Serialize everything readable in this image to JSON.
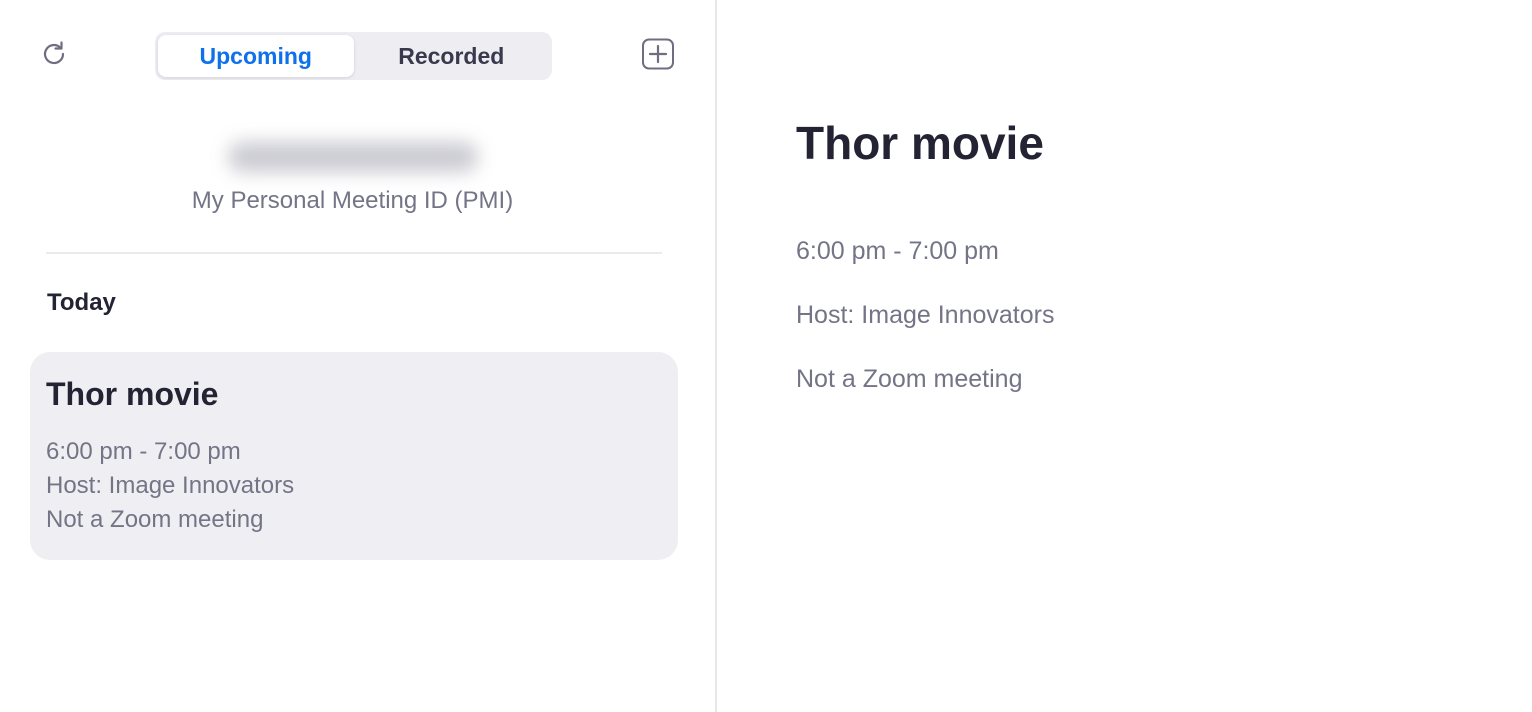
{
  "toolbar": {
    "refresh_icon": "refresh-icon",
    "add_icon": "plus-square-icon",
    "tabs": [
      {
        "label": "Upcoming",
        "active": true
      },
      {
        "label": "Recorded",
        "active": false
      }
    ]
  },
  "pmi": {
    "label": "My Personal Meeting ID (PMI)"
  },
  "list": {
    "section_heading": "Today",
    "meetings": [
      {
        "title": "Thor movie",
        "time": "6:00 pm - 7:00 pm",
        "host": "Host: Image Innovators",
        "note": "Not a Zoom meeting"
      }
    ]
  },
  "detail": {
    "title": "Thor movie",
    "time": "6:00 pm - 7:00 pm",
    "host": "Host: Image Innovators",
    "note": "Not a Zoom meeting"
  },
  "colors": {
    "accent": "#0e71eb",
    "card_bg": "#efeff3",
    "muted_text": "#747487",
    "primary_text": "#232333"
  }
}
